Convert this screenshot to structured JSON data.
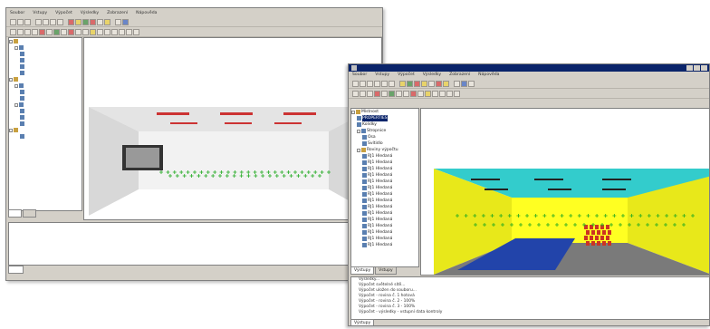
{
  "colors": {
    "room1_back": "#f2f2f2",
    "room2_back": "#ffff22",
    "room2_ceiling": "#33cccc",
    "room2_floor_area": "#2244aa",
    "grid_marks": "#22aa22",
    "luminaire_red": "#cc3333",
    "seats": "#cc3322"
  },
  "icons": [
    "app-icon",
    "minimize-icon",
    "maximize-icon",
    "close-icon",
    "tree-expand-icon",
    "folder-icon",
    "object-icon"
  ],
  "w2": {
    "menu": [
      "Soubor",
      "Vstupy",
      "Výpočet",
      "Výsledky",
      "Zobrazení",
      "Nápověda"
    ],
    "tree_items": [
      "Místnost",
      "PROPERTIES",
      "Kolidky",
      "Stropnice",
      "Osa",
      "Svítidlo",
      "Roviny výpočtu",
      "RJ1 Hledaná",
      "RJ1 Hledaná",
      "RJ1 Hledaná",
      "RJ1 Hledaná",
      "RJ1 Hledaná",
      "RJ1 Hledaná",
      "RJ1 Hledaná",
      "RJ1 Hledaná",
      "RJ1 Hledaná",
      "RJ1 Hledaná",
      "RJ1 Hledaná",
      "RJ1 Hledaná",
      "RJ1 Hledaná",
      "RJ1 Hledaná",
      "RJ1 Hledaná"
    ],
    "tabs": [
      "Výstupy",
      "Vstupy"
    ],
    "log_lines": [
      "Výsledky...",
      "Výpočet světelné sítě...",
      "Výpočet uložen do souboru...",
      "Výpočet - rovina č. 1 hotová",
      "Výpočet - rovina č. 2 - 100%",
      "Výpočet - rovina č. 3 - 100%",
      "Výpočet - výsledky - vstupní data kontroly"
    ],
    "bottom_tab": "Výstupy"
  }
}
